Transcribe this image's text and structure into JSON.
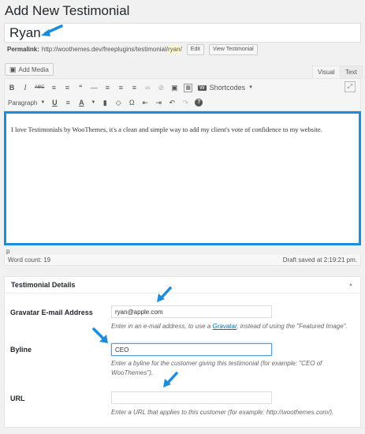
{
  "page_title": "Add New Testimonial",
  "title_value": "Ryan",
  "permalink": {
    "label": "Permalink:",
    "base": "http://woothemes.dev/freeplugins/testimonial/",
    "slug": "ryan",
    "trail": "/",
    "edit_label": "Edit",
    "view_label": "View Testimonial"
  },
  "media": {
    "add_media_label": "Add Media"
  },
  "editor_tabs": {
    "visual": "Visual",
    "text": "Text"
  },
  "toolbar": {
    "row1_icons": [
      "bold-icon",
      "italic-icon",
      "strikethrough-icon",
      "bulleted-list-icon",
      "numbered-list-icon",
      "blockquote-icon",
      "horizontal-rule-icon",
      "align-left-icon",
      "align-center-icon",
      "align-right-icon",
      "link-icon",
      "unlink-icon",
      "read-more-icon",
      "toolbar-toggle-icon",
      "shortcodes-icon"
    ],
    "shortcodes_label": "Shortcodes",
    "paragraph_label": "Paragraph",
    "row2_icons": [
      "underline-icon",
      "justify-icon",
      "text-color-icon",
      "paste-text-icon",
      "clear-formatting-icon",
      "special-char-icon",
      "outdent-icon",
      "indent-icon",
      "undo-icon",
      "redo-icon",
      "help-icon"
    ]
  },
  "editor": {
    "content": "I love Testimonials by WooThemes, it's a clean and simple way to add my client's vote of confidence to my website.",
    "path": "p",
    "word_count": "Word count: 19",
    "draft_saved": "Draft saved at 2:19:21 pm."
  },
  "testimonial_details": {
    "heading": "Testimonial Details",
    "gravatar": {
      "label": "Gravatar E-mail Address",
      "value": "ryan@apple.com",
      "desc_before": "Enter in an e-mail address, to use a ",
      "desc_link": "Gravatar",
      "desc_after": ", instead of using the \"Featured Image\"."
    },
    "byline": {
      "label": "Byline",
      "value": "CEO",
      "desc": "Enter a byline for the customer giving this testimonial (for example: \"CEO of WooThemes\")."
    },
    "url": {
      "label": "URL",
      "value": "",
      "desc": "Enter a URL that applies to this customer (for example: http://woothemes.com/)."
    }
  },
  "colors": {
    "accent": "#1e8cda",
    "link": "#0073aa",
    "slug_highlight": "#fffbcc"
  }
}
